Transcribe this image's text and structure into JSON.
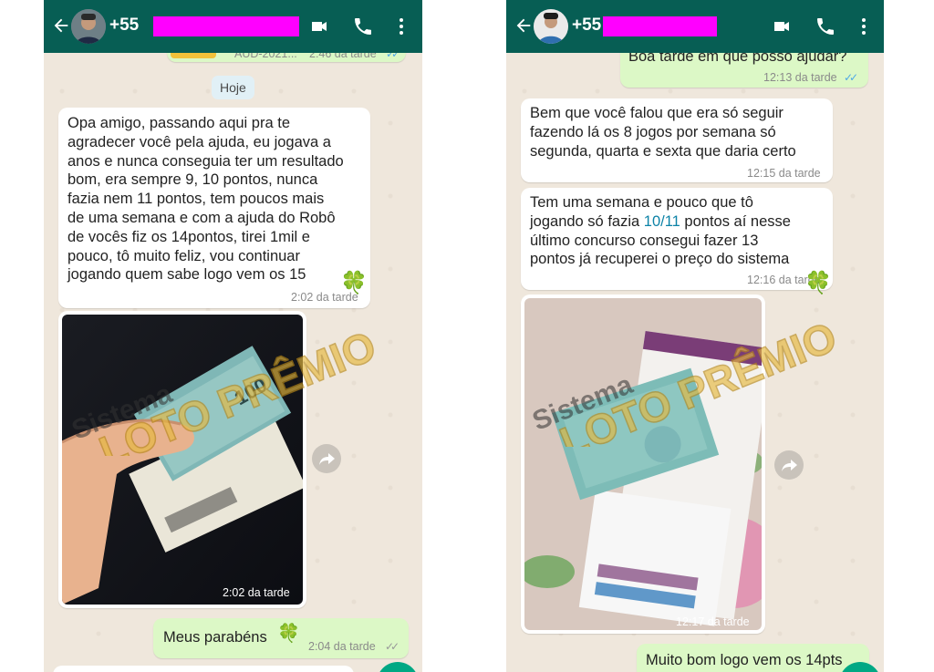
{
  "brand": {
    "accent": "#075e54",
    "outgoing_bubble": "#dcf8c6",
    "incoming_bubble": "#ffffff"
  },
  "watermark": {
    "line1": "Sistema",
    "line2": "LOTO PRÊMIO"
  },
  "left_chat": {
    "header": {
      "phone": "+55",
      "icons": [
        "back-arrow-icon",
        "video-call-icon",
        "phone-call-icon",
        "more-vert-icon"
      ]
    },
    "partial_top": {
      "text": "AUD-2021...",
      "time": "2:46 da tarde"
    },
    "date_chip": "Hoje",
    "message1": {
      "text": "Opa amigo, passando aqui pra te\nagradecer você pela ajuda, eu jogava a\nanos e nunca conseguia ter um resultado\nbom, era sempre 9, 10 pontos, nunca\nfazia nem 11 pontos, tem poucos mais\nde uma semana e com a ajuda do Robô\nde vocês fiz os 14pontos, tirei 1mil e\npouco, tô muito feliz, vou continuar\njogando quem sabe logo vem os 15",
      "time": "2:02 da tarde"
    },
    "photo": {
      "time": "2:02 da tarde"
    },
    "reply": {
      "text": "Meus parabéns",
      "time": "2:04 da tarde"
    }
  },
  "right_chat": {
    "header": {
      "phone": "+55",
      "icons": [
        "back-arrow-icon",
        "video-call-icon",
        "phone-call-icon",
        "more-vert-icon"
      ]
    },
    "partial_top": {
      "text": "Boa tarde em que posso ajudar?",
      "time": "12:13 da tarde"
    },
    "message1": {
      "text": "Bem que você falou que era só seguir\nfazendo lá os 8 jogos por semana só\nsegunda, quarta e sexta que daria certo",
      "time": "12:15 da tarde"
    },
    "message2": {
      "part1": "Tem uma semana e pouco que tô\njogando só fazia ",
      "link": "10/11",
      "part2": " pontos aí nesse\núltimo concurso consegui fazer 13\npontos já recuperei o preço do sistema",
      "time": "12:16 da tarde"
    },
    "photo": {
      "time": "12:17 da tarde"
    },
    "partial_bottom": {
      "text": "Muito bom logo vem os 14pts"
    }
  }
}
